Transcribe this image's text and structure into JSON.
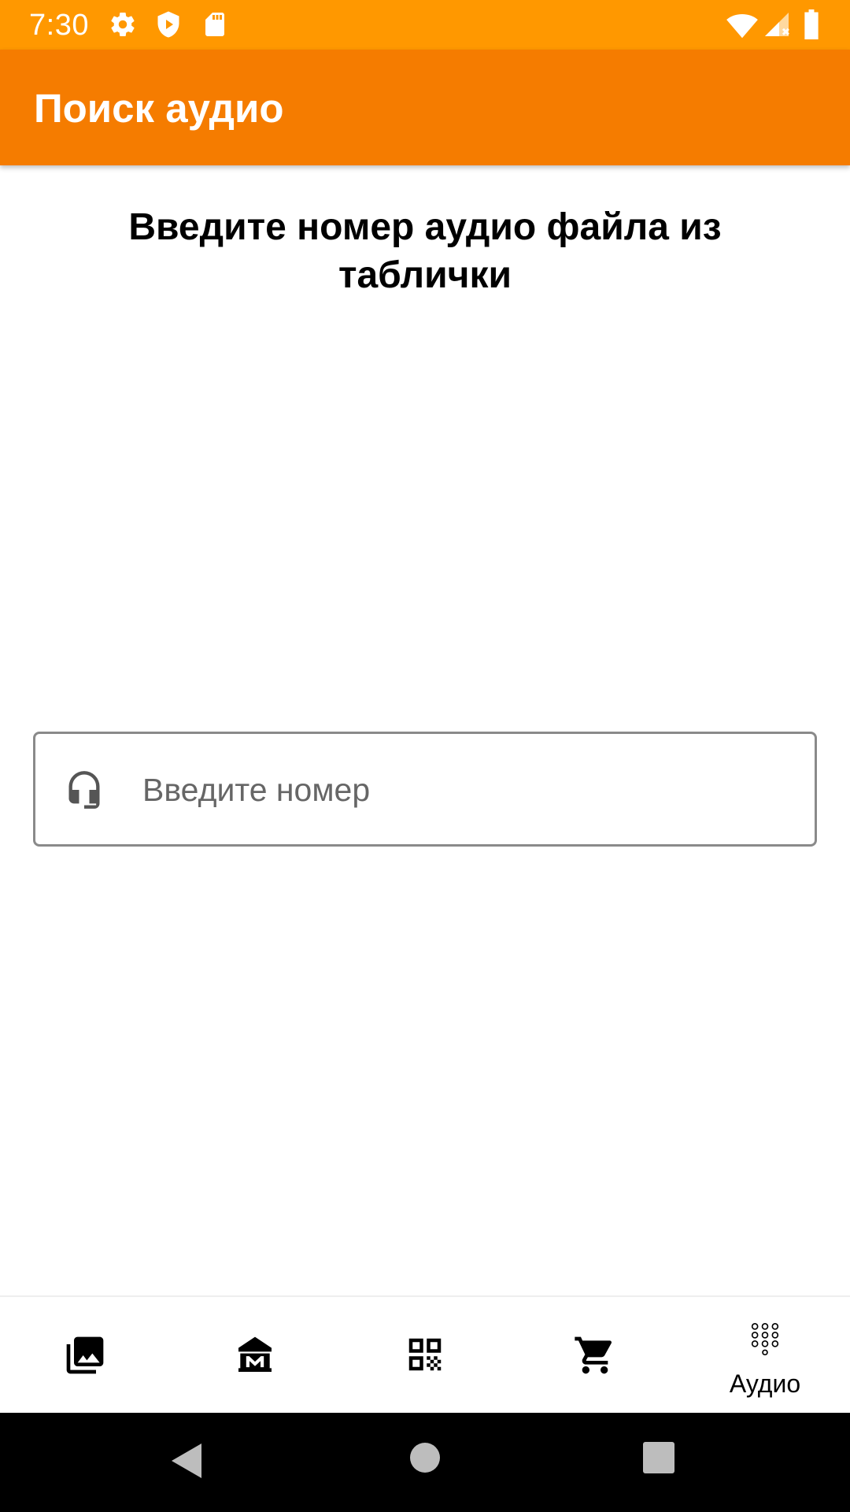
{
  "status_bar": {
    "time": "7:30",
    "left_icons": [
      "gear-icon",
      "shield-icon",
      "sd-card-icon"
    ],
    "right_icons": [
      "wifi-icon",
      "signal-icon",
      "battery-icon"
    ],
    "background": "#ff9800"
  },
  "app_bar": {
    "title": "Поиск аудио",
    "background": "#f57c00"
  },
  "main": {
    "heading": "Введите номер аудио файла из таблички",
    "search": {
      "icon": "headset-icon",
      "placeholder": "Введите номер",
      "value": ""
    }
  },
  "bottom_nav": {
    "items": [
      {
        "icon": "gallery-icon",
        "label": ""
      },
      {
        "icon": "museum-icon",
        "label": ""
      },
      {
        "icon": "qr-code-icon",
        "label": ""
      },
      {
        "icon": "cart-icon",
        "label": ""
      },
      {
        "icon": "dialpad-icon",
        "label": "Аудио",
        "active": true
      }
    ]
  },
  "system_nav": {
    "buttons": [
      "back-icon",
      "home-icon",
      "recents-icon"
    ]
  }
}
